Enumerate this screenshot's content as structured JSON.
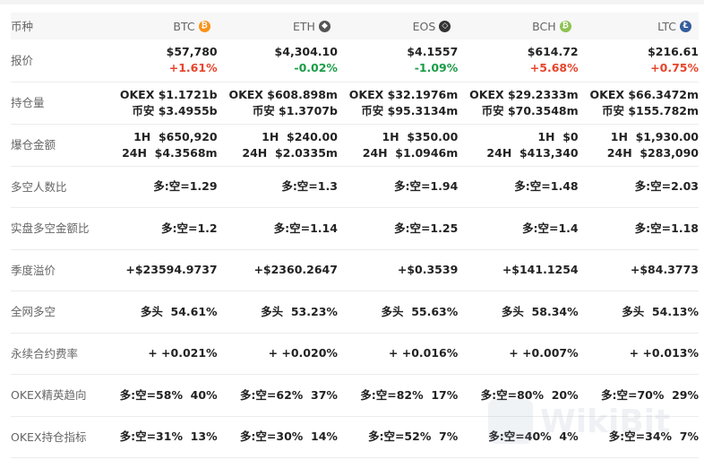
{
  "header": {
    "label": "币种",
    "coins": [
      {
        "name": "BTC",
        "icon": "btc-icon",
        "icon_glyph": "₿",
        "color": "#f7931a"
      },
      {
        "name": "ETH",
        "icon": "eth-icon",
        "icon_glyph": "◆",
        "color": "#555555"
      },
      {
        "name": "EOS",
        "icon": "eos-icon",
        "icon_glyph": "◇",
        "color": "#333333"
      },
      {
        "name": "BCH",
        "icon": "bch-icon",
        "icon_glyph": "₿",
        "color": "#8dc351"
      },
      {
        "name": "LTC",
        "icon": "ltc-icon",
        "icon_glyph": "Ł",
        "color": "#345d9d"
      }
    ]
  },
  "rows": {
    "price": {
      "label": "报价",
      "values": [
        "$57,780",
        "$4,304.10",
        "$4.1557",
        "$614.72",
        "$216.61"
      ],
      "changes": [
        "+1.61%",
        "-0.02%",
        "-1.09%",
        "+5.68%",
        "+0.75%"
      ]
    },
    "open_interest": {
      "label": "持仓量",
      "line1": [
        "OKEX $1.1721b",
        "OKEX $608.898m",
        "OKEX $32.1976m",
        "OKEX $29.2333m",
        "OKEX $66.3472m"
      ],
      "line2": [
        "币安 $3.4955b",
        "币安 $1.3707b",
        "币安 $95.3134m",
        "币安 $70.3548m",
        "币安 $155.782m"
      ]
    },
    "liquidation": {
      "label": "爆仓金额",
      "line1": [
        "1H  $650,920",
        "1H  $240.00",
        "1H  $350.00",
        "1H  $0",
        "1H  $1,930.00"
      ],
      "line2": [
        "24H  $4.3568m",
        "24H  $2.0335m",
        "24H  $1.0946m",
        "24H  $413,340",
        "24H  $283,090"
      ]
    },
    "long_short_accounts": {
      "label": "多空人数比",
      "values": [
        "多:空=1.29",
        "多:空=1.3",
        "多:空=1.94",
        "多:空=1.48",
        "多:空=2.03"
      ]
    },
    "taker_ratio": {
      "label": "实盘多空金额比",
      "values": [
        "多:空=1.2",
        "多:空=1.14",
        "多:空=1.25",
        "多:空=1.4",
        "多:空=1.18"
      ]
    },
    "quarterly_premium": {
      "label": "季度溢价",
      "values": [
        "+$23594.9737",
        "+$2360.2647",
        "+$0.3539",
        "+$141.1254",
        "+$84.3773"
      ]
    },
    "network_long_short": {
      "label": "全网多空",
      "values": [
        "多头  54.61%",
        "多头  53.23%",
        "多头  55.63%",
        "多头  58.34%",
        "多头  54.13%"
      ]
    },
    "funding_rate": {
      "label": "永续合约费率",
      "values": [
        "+ +0.021%",
        "+ +0.020%",
        "+ +0.016%",
        "+ +0.007%",
        "+ +0.013%"
      ]
    },
    "okex_elite": {
      "label": "OKEX精英趋向",
      "values": [
        "多:空=58%  40%",
        "多:空=62%  37%",
        "多:空=82%  17%",
        "多:空=80%  20%",
        "多:空=70%  29%"
      ]
    },
    "okex_position": {
      "label": "OKEX持仓指标",
      "values": [
        "多:空=31%  13%",
        "多:空=30%  14%",
        "多:空=52%  7%",
        "多:空=40%  4%",
        "多:空=34%  7%"
      ]
    }
  },
  "watermark": {
    "text": "WikiBit"
  }
}
